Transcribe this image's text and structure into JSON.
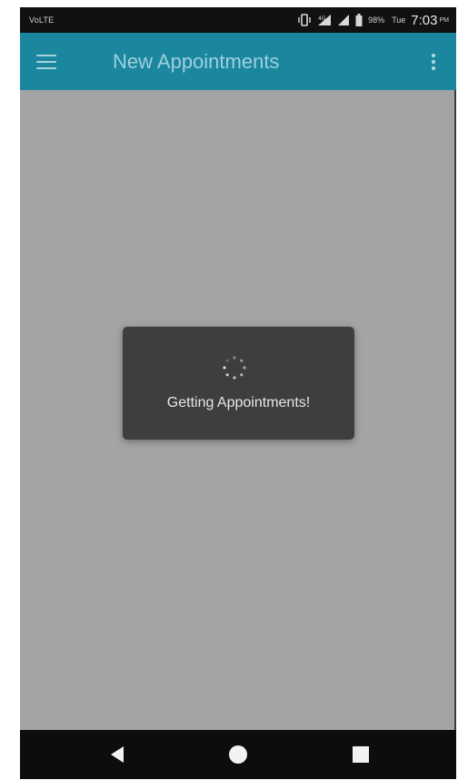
{
  "status_bar": {
    "carrier": "VoLTE",
    "battery_percent": "98%",
    "day": "Tue",
    "time": "7:03",
    "ampm": "PM",
    "icons": [
      "vibrate-icon",
      "signal-4g-icon",
      "signal-icon",
      "battery-icon"
    ]
  },
  "app_bar": {
    "title": "New Appointments",
    "menu_icon": "hamburger-menu-icon",
    "overflow_icon": "more-vert-icon",
    "color": "#1a879f"
  },
  "loading_dialog": {
    "message": "Getting Appointments!",
    "icon": "spinner-icon"
  },
  "nav_bar": {
    "buttons": [
      "back-icon",
      "home-icon",
      "recents-icon"
    ]
  },
  "colors": {
    "content_background": "#a4a4a4",
    "dialog_background": "#3e3e3e"
  }
}
